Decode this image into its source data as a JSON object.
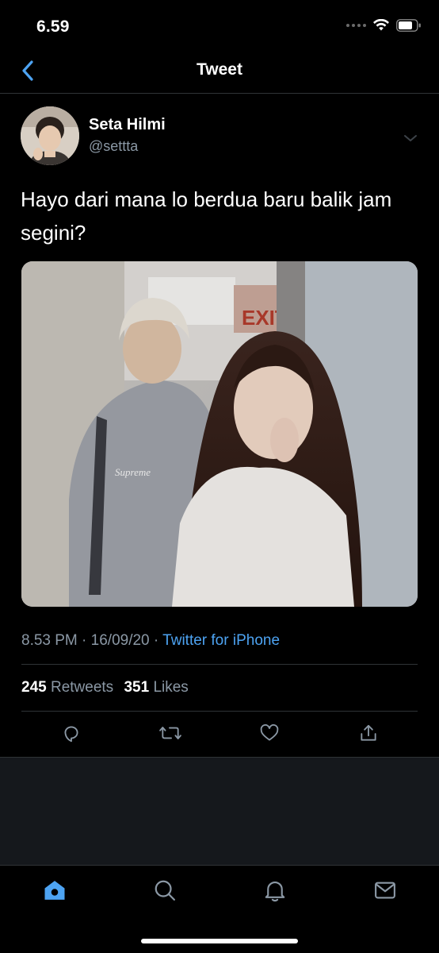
{
  "status_bar": {
    "time": "6.59"
  },
  "nav": {
    "title": "Tweet"
  },
  "tweet": {
    "author_name": "Seta Hilmi",
    "author_handle": "@settta",
    "text": "Hayo dari mana lo berdua baru balik jam segini?",
    "time": "8.53 PM",
    "date": "16/09/20",
    "source": "Twitter for iPhone",
    "retweets": "245",
    "retweets_label": "Retweets",
    "likes": "351",
    "likes_label": "Likes",
    "photo_sign_text": "EXIT",
    "photo_hoodie_text": "Supreme"
  },
  "colors": {
    "background": "#000000",
    "accent": "#4da3f2",
    "secondary_text": "#8b98a5",
    "divider": "#2f3336"
  },
  "icons": {
    "back": "chevron-left-icon",
    "more": "chevron-down-icon",
    "reply": "reply-icon",
    "retweet": "retweet-icon",
    "like": "heart-icon",
    "share": "share-icon",
    "home": "home-icon",
    "search": "search-icon",
    "notifications": "bell-icon",
    "messages": "mail-icon"
  }
}
